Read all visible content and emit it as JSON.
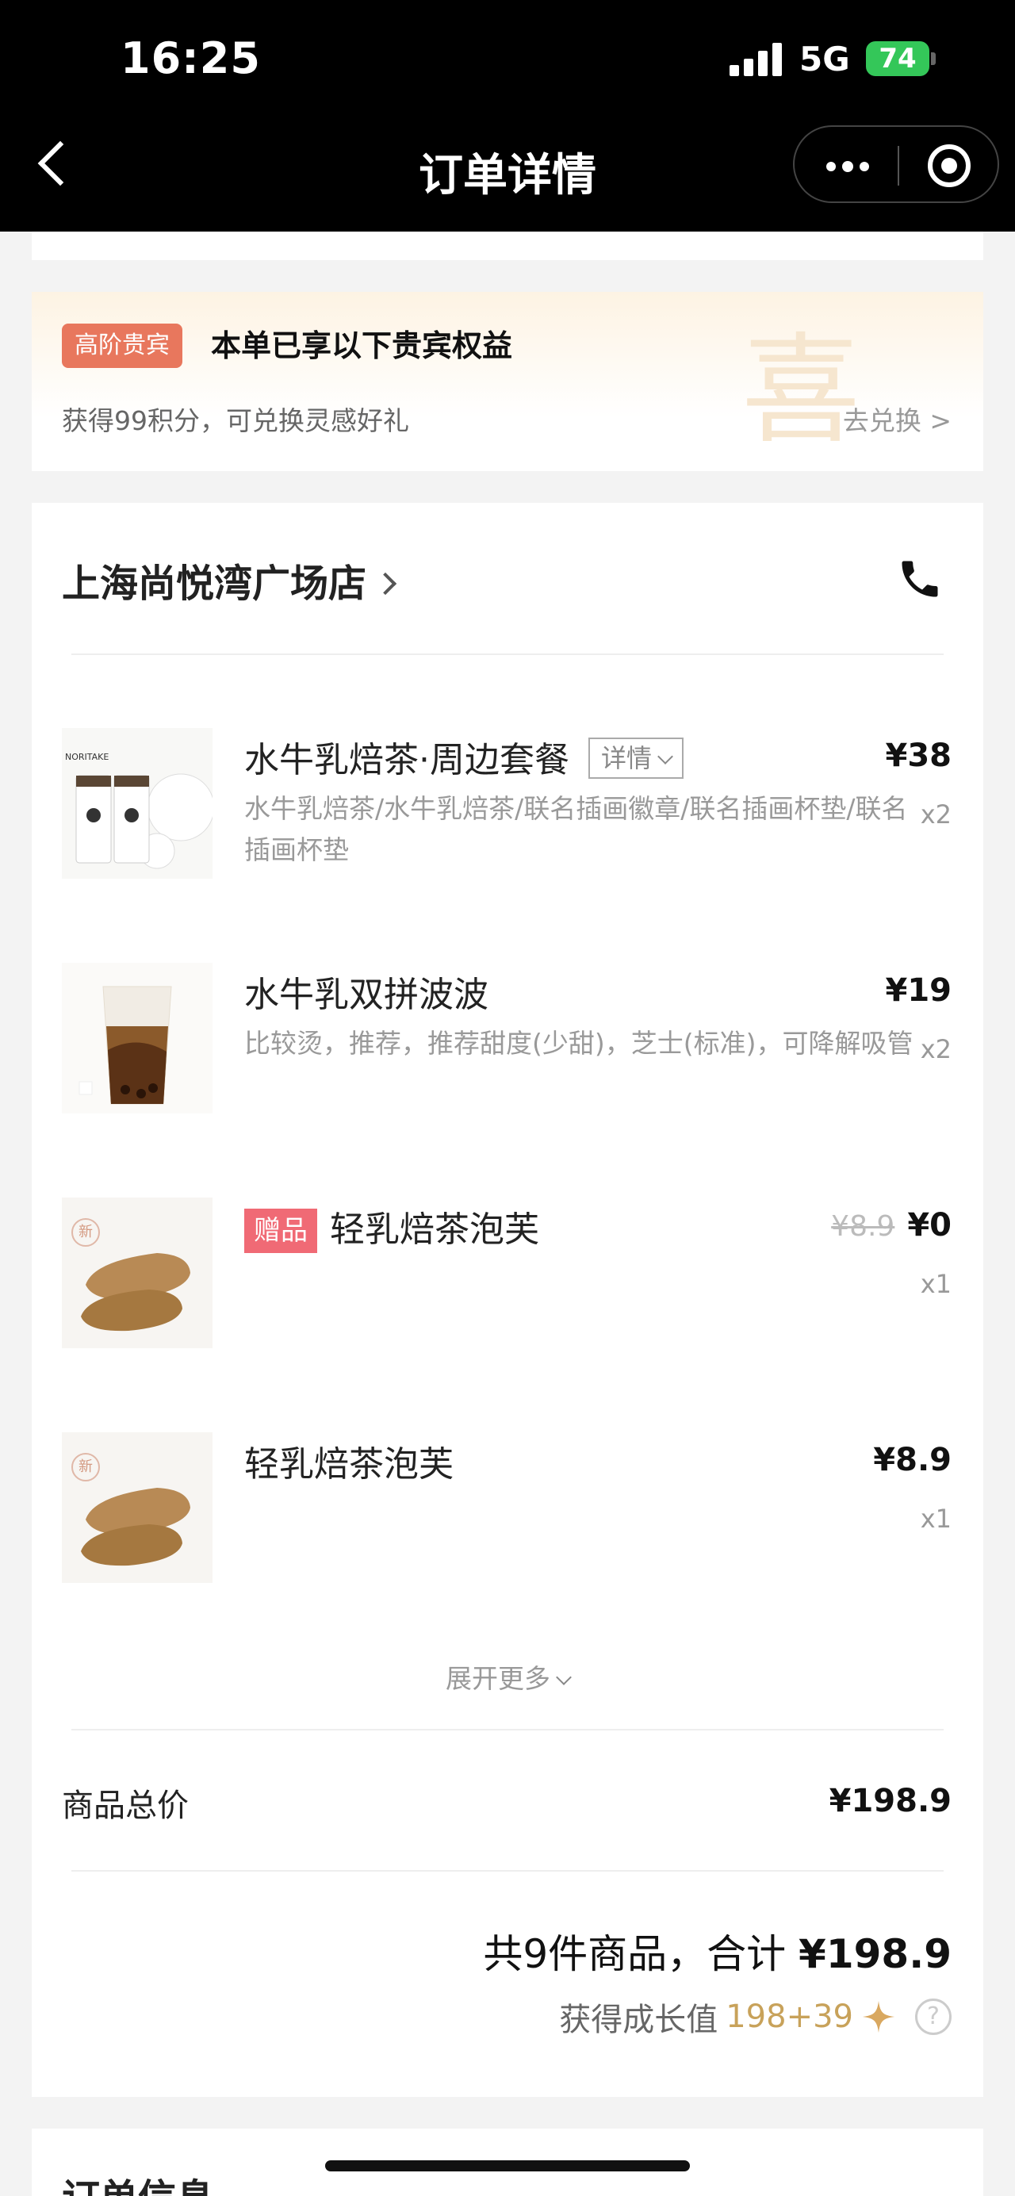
{
  "status_bar": {
    "time": "16:25",
    "network": "5G",
    "battery": "74"
  },
  "nav": {
    "title": "订单详情"
  },
  "vip": {
    "badge": "高阶贵宾",
    "title": "本单已享以下贵宾权益",
    "subtitle": "获得99积分，可兑换灵感好礼",
    "watermark": "喜",
    "link": "去兑换 >"
  },
  "store": {
    "name": "上海尚悦湾广场店"
  },
  "items": [
    {
      "name": "水牛乳焙茶·周边套餐",
      "detail_label": "详情",
      "desc": "水牛乳焙茶/水牛乳焙茶/联名插画徽章/联名插画杯垫/联名插画杯垫",
      "price": "¥38",
      "qty": "x2",
      "thumb_text": "NORITAKE"
    },
    {
      "name": "水牛乳双拼波波",
      "desc": "比较烫，推荐，推荐甜度(少甜)，芝士(标准)，可降解吸管",
      "price": "¥19",
      "qty": "x2"
    },
    {
      "tag": "赠品",
      "name": "轻乳焙茶泡芙",
      "old_price": "¥8.9",
      "price": "¥0",
      "qty": "x1",
      "thumb_badge": "新"
    },
    {
      "name": "轻乳焙茶泡芙",
      "price": "¥8.9",
      "qty": "x1",
      "thumb_badge": "新"
    }
  ],
  "expand_label": "展开更多",
  "summary": {
    "label": "商品总价",
    "value": "¥198.9",
    "total_text": "共9件商品，合计",
    "total_value": "¥198.9",
    "growth_label": "获得成长值",
    "growth_value": "198+39"
  },
  "order_info": {
    "title": "订单信息"
  },
  "colors": {
    "vip_badge": "#e8775d",
    "gift_tag": "#f06a75",
    "growth": "#c8a25a",
    "battery": "#34c759"
  }
}
